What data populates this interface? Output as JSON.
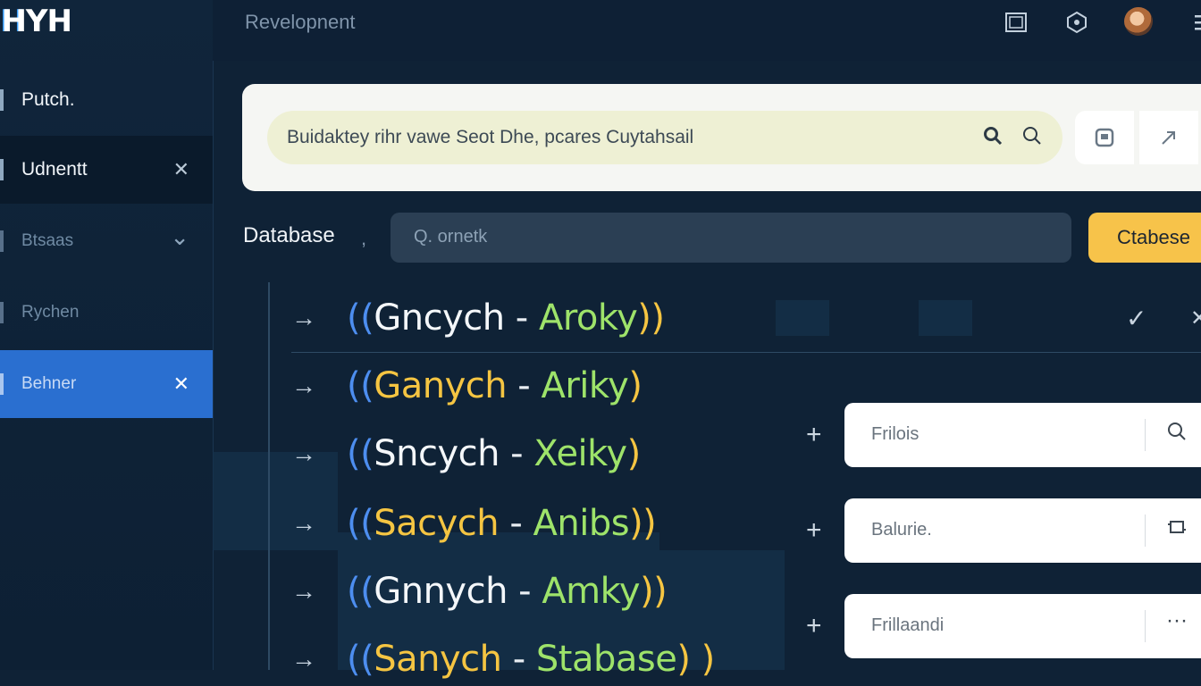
{
  "app": {
    "logo": "HYH",
    "logo_accent": "H"
  },
  "topbar": {
    "title": "Revelopnent",
    "icons": [
      "window-icon",
      "hexagon-icon",
      "avatar",
      "menu-icon"
    ]
  },
  "sidebar": {
    "items": [
      {
        "label": "Putch.",
        "trail": ""
      },
      {
        "label": "Udnentt",
        "trail": "✕"
      },
      {
        "label": "Btsaas",
        "trail": "⌄"
      },
      {
        "label": "Rychen",
        "trail": ""
      },
      {
        "label": "Behner",
        "trail": "✕"
      }
    ]
  },
  "search": {
    "text": "Buidaktey rihr vawe Seot Dhe, pcares Cuytahsail"
  },
  "database": {
    "label": "Database",
    "comma": ",",
    "search_text": "Q. ornetk",
    "button_label": "Ctabese"
  },
  "list": {
    "rows": [
      {
        "open": "((",
        "w1": "Gncych",
        "dash": " - ",
        "w2": "Aroky",
        "close": "))"
      },
      {
        "open": "((",
        "w1": "Ganych",
        "dash": " - ",
        "w2": "Ariky",
        "close": ")"
      },
      {
        "open": "((",
        "w1": "Sncych",
        "dash": " - ",
        "w2": "Xeiky",
        "close": ")"
      },
      {
        "open": "((",
        "w1": "Sacych",
        "dash": " - ",
        "w2": "Anibs",
        "close": "))"
      },
      {
        "open": "((",
        "w1": "Gnnych",
        "dash": " - ",
        "w2": "Amky",
        "close": "))"
      },
      {
        "open": "((",
        "w1": "Sanych",
        "dash": " - ",
        "w2": "Stabase",
        "close": ") )"
      }
    ],
    "arrow": "→",
    "row1_check": "✓",
    "row1_close": "✕"
  },
  "float_inputs": [
    {
      "text": "Frilois",
      "icon": "⚲"
    },
    {
      "text": "Balurie.",
      "icon": "⌑"
    },
    {
      "text": "Frillaandi",
      "icon": "···"
    }
  ],
  "plus": "+"
}
